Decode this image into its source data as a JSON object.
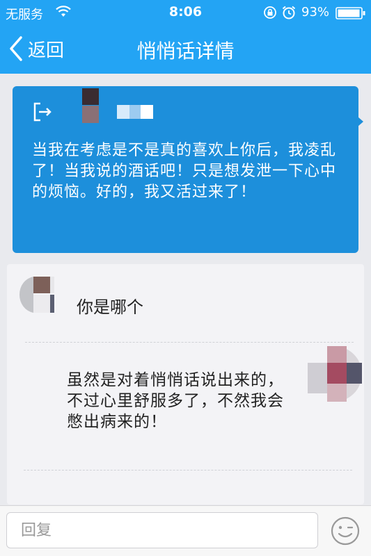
{
  "status_bar": {
    "carrier": "无服务",
    "time": "8:06",
    "battery_percent": "93%"
  },
  "nav": {
    "back_label": "返回",
    "title": "悄悄话详情"
  },
  "post": {
    "text": "当我在考虑是不是真的喜欢上你后，我凌乱了！当我说的酒话吧！只是想发泄一下心中的烦恼。好的，我又活过来了！"
  },
  "thread": {
    "reply_text": "你是哪个",
    "my_reply_text": "虽然是对着悄悄话说出来的，不过心里舒服多了，不然我会憋出病来的！"
  },
  "input": {
    "placeholder": "回复"
  },
  "colors": {
    "header_bg": "#23a4f4",
    "post_bg": "#1d8fdb",
    "thread_bg": "#f3f3f6"
  },
  "icons": {
    "wifi": "wifi-icon",
    "lock": "rotation-lock-icon",
    "alarm": "alarm-icon",
    "battery": "battery-icon",
    "back": "chevron-left-icon",
    "logout": "logout-icon",
    "emoji": "smiley-icon"
  }
}
